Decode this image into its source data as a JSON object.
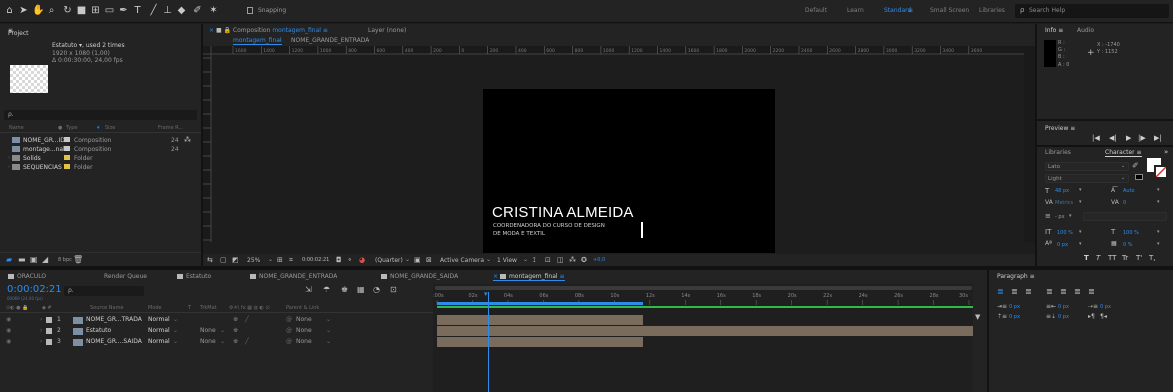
{
  "toolbar": {
    "snapping_label": "Snapping",
    "workspaces": [
      "Default",
      "Learn",
      "Standard",
      "Small Screen",
      "Libraries"
    ],
    "active_workspace": "Standard",
    "search_placeholder": "Search Help"
  },
  "project": {
    "title": "Project",
    "selected_name": "Estatuto",
    "selected_usage": ", used 2 times",
    "selected_dims": "1920 x 1080 (1,00)",
    "selected_duration": "Δ 0:00:30:00, 24,00 fps",
    "search_glyph": "ρ.",
    "columns": [
      "Name",
      "Type",
      "Size",
      "Frame R..."
    ],
    "items": [
      {
        "name": "NOME_GR...IDA",
        "type": "Composition",
        "rate": "24",
        "color": "#c8c8c8",
        "icon": "composition-icon"
      },
      {
        "name": "montage...nal",
        "type": "Composition",
        "rate": "24",
        "color": "#c8c8c8",
        "icon": "composition-icon"
      },
      {
        "name": "Solids",
        "type": "Folder",
        "rate": "",
        "color": "#e3c24a",
        "icon": "folder-icon"
      },
      {
        "name": "SEQUENCIAS",
        "type": "Folder",
        "rate": "",
        "color": "#e3c24a",
        "icon": "folder-icon"
      }
    ],
    "footer_bpc": "8 bpc"
  },
  "composition": {
    "tab_label": "Composition",
    "comp_name": "montagem_final",
    "layer_label": "Layer (none)",
    "crumbs": [
      "montagem_final",
      "NOME_GRANDE_ENTRADA"
    ],
    "ruler_ticks": [
      "1600",
      "1400",
      "1200",
      "1000",
      "800",
      "600",
      "400",
      "200",
      "0",
      "200",
      "400",
      "600",
      "800",
      "1000",
      "1200",
      "1400",
      "1600",
      "1800",
      "2000",
      "2200",
      "2400",
      "2600",
      "2800",
      "3000",
      "3200",
      "3400",
      "3600"
    ],
    "overlay_name": "CRISTINA ALMEIDA",
    "overlay_line1": "COORDENADORA DO CURSO DE DESIGN",
    "overlay_line2": "DE MODA E TÊXTIL",
    "zoom": "25%",
    "timecode": "0:00:02:21",
    "resolution": "(Quarter)",
    "camera": "Active Camera",
    "view": "1 View",
    "exposure": "+0,0"
  },
  "info": {
    "tabs": [
      "Info",
      "Audio"
    ],
    "channels": [
      "R :",
      "G :",
      "B :",
      "A : 0"
    ],
    "x": "X : -1740",
    "y": "Y : 1152"
  },
  "preview": {
    "title": "Preview"
  },
  "character": {
    "tabs": [
      "Libraries",
      "Character"
    ],
    "font": "Lato",
    "style": "Light",
    "size": "48 px",
    "leading": "Auto",
    "kerning": "Metrics",
    "tracking": "0",
    "stroke": "- px",
    "vscale": "100 %",
    "hscale": "100 %",
    "baseline": "0 px",
    "tsume": "0 %",
    "style_buttons": [
      "T",
      "T",
      "TT",
      "Tr",
      "T'",
      "T,"
    ]
  },
  "timeline": {
    "tabs": [
      "ORACULO",
      "Render Queue",
      "Estatuto",
      "NOME_GRANDE_ENTRADA",
      "NOME_GRANDE_SAIDA",
      "montagem_final"
    ],
    "tab_colors": [
      "#b9b9b9",
      "",
      "#b9b9b9",
      "#b9b9b9",
      "#b9b9b9",
      "#b9b9b9"
    ],
    "current_time": "0:00:02:21",
    "frame_info": "00069 (24.00 fps)",
    "columns": [
      "Source Name",
      "Mode",
      "T",
      "TrkMat",
      "Parent & Link"
    ],
    "time_ticks": [
      ":00s",
      "02s",
      "04s",
      "06s",
      "08s",
      "10s",
      "12s",
      "14s",
      "16s",
      "18s",
      "20s",
      "22s",
      "24s",
      "26s",
      "28s",
      "30s"
    ],
    "layers": [
      {
        "num": "1",
        "name": "NOME_GR...TRADA",
        "mode": "Normal",
        "trkmat": "",
        "parent": "None",
        "color": "#b9b9b9"
      },
      {
        "num": "2",
        "name": "Estatuto",
        "mode": "Normal",
        "trkmat": "None",
        "parent": "None",
        "color": "#b9b9b9"
      },
      {
        "num": "3",
        "name": "NOME_GR....SAIDA",
        "mode": "Normal",
        "trkmat": "None",
        "parent": "None",
        "color": "#b9b9b9"
      }
    ]
  },
  "paragraph": {
    "title": "Paragraph",
    "indent_left": "0 px",
    "indent_right": "0 px",
    "indent_first": "0 px",
    "space_before": "0 px",
    "space_after": "0 px"
  }
}
